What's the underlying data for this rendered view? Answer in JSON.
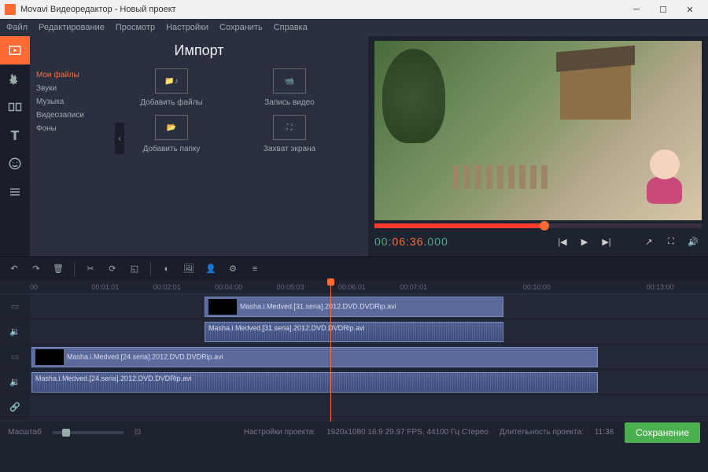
{
  "window": {
    "title": "Movavi Видеоредактор - Новый проект"
  },
  "menubar": {
    "file": "Файл",
    "edit": "Редактирование",
    "view": "Просмотр",
    "settings": "Настройки",
    "save": "Сохранить",
    "help": "Справка"
  },
  "import": {
    "title": "Импорт",
    "cats": {
      "my_files": "Мои файлы",
      "sounds": "Звуки",
      "music": "Музыка",
      "video": "Видеозаписи",
      "backgrounds": "Фоны"
    },
    "cells": {
      "add_files": "Добавить файлы",
      "record_video": "Запись видео",
      "add_folder": "Добавить папку",
      "record_screen": "Захват экрана"
    }
  },
  "timecode": {
    "pre": "00:",
    "mid": "06:36",
    "post": ".000"
  },
  "ruler": [
    "00",
    "00:01:01",
    "00:02:01",
    "00:04:00",
    "00:05:03",
    "00:06:01",
    "00:07:01",
    "",
    "00:10:00",
    "",
    "00:13:00"
  ],
  "clips": {
    "v1": "Masha.i.Medved.[31.seria].2012.DVD.DVDRip.avi",
    "a1": "Masha.i.Medved.[31.seria].2012.DVD.DVDRip.avi",
    "v2": "Masha.i.Medved.[24.seria].2012.DVD.DVDRip.avi",
    "a2": "Masha.i.Medved.[24.seria].2012.DVD.DVDRip.avi"
  },
  "footer": {
    "scale": "Масштаб",
    "project_label": "Настройки проекта:",
    "project_value": "1920x1080 16:9 29.97 FPS, 44100 Гц Стерео",
    "duration_label": "Длительность проекта:",
    "duration_value": "11:38",
    "save": "Сохранение"
  }
}
